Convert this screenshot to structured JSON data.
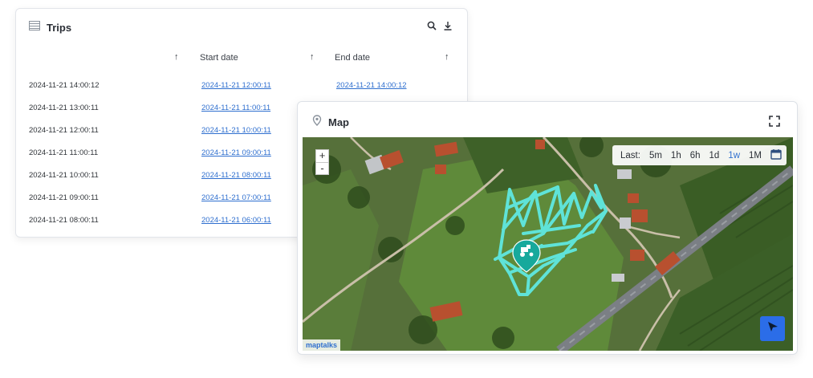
{
  "trips": {
    "title": "Trips",
    "columns": {
      "start": "Start date",
      "end": "End date"
    },
    "rows": [
      {
        "created": "2024-11-21 14:00:12",
        "start": "2024-11-21 12:00:11",
        "end": "2024-11-21 14:00:12"
      },
      {
        "created": "2024-11-21 13:00:11",
        "start": "2024-11-21 11:00:11",
        "end": ""
      },
      {
        "created": "2024-11-21 12:00:11",
        "start": "2024-11-21 10:00:11",
        "end": ""
      },
      {
        "created": "2024-11-21 11:00:11",
        "start": "2024-11-21 09:00:11",
        "end": ""
      },
      {
        "created": "2024-11-21 10:00:11",
        "start": "2024-11-21 08:00:11",
        "end": ""
      },
      {
        "created": "2024-11-21 09:00:11",
        "start": "2024-11-21 07:00:11",
        "end": ""
      },
      {
        "created": "2024-11-21 08:00:11",
        "start": "2024-11-21 06:00:11",
        "end": ""
      }
    ]
  },
  "map": {
    "title": "Map",
    "zoom_in": "+",
    "zoom_out": "-",
    "range_label": "Last:",
    "range_options": [
      "5m",
      "1h",
      "6h",
      "1d",
      "1w",
      "1M"
    ],
    "range_selected": "1w",
    "attribution": "maptalks",
    "track_color": "#5fe3d8",
    "marker_color": "#17a99c"
  },
  "icons": {
    "trips": "table-icon",
    "search": "search-icon",
    "download": "download-icon",
    "map": "map-pin-icon",
    "fullscreen": "fullscreen-icon",
    "calendar": "calendar-icon",
    "locate": "navigation-arrow-icon",
    "marker": "tractor-marker-icon"
  }
}
